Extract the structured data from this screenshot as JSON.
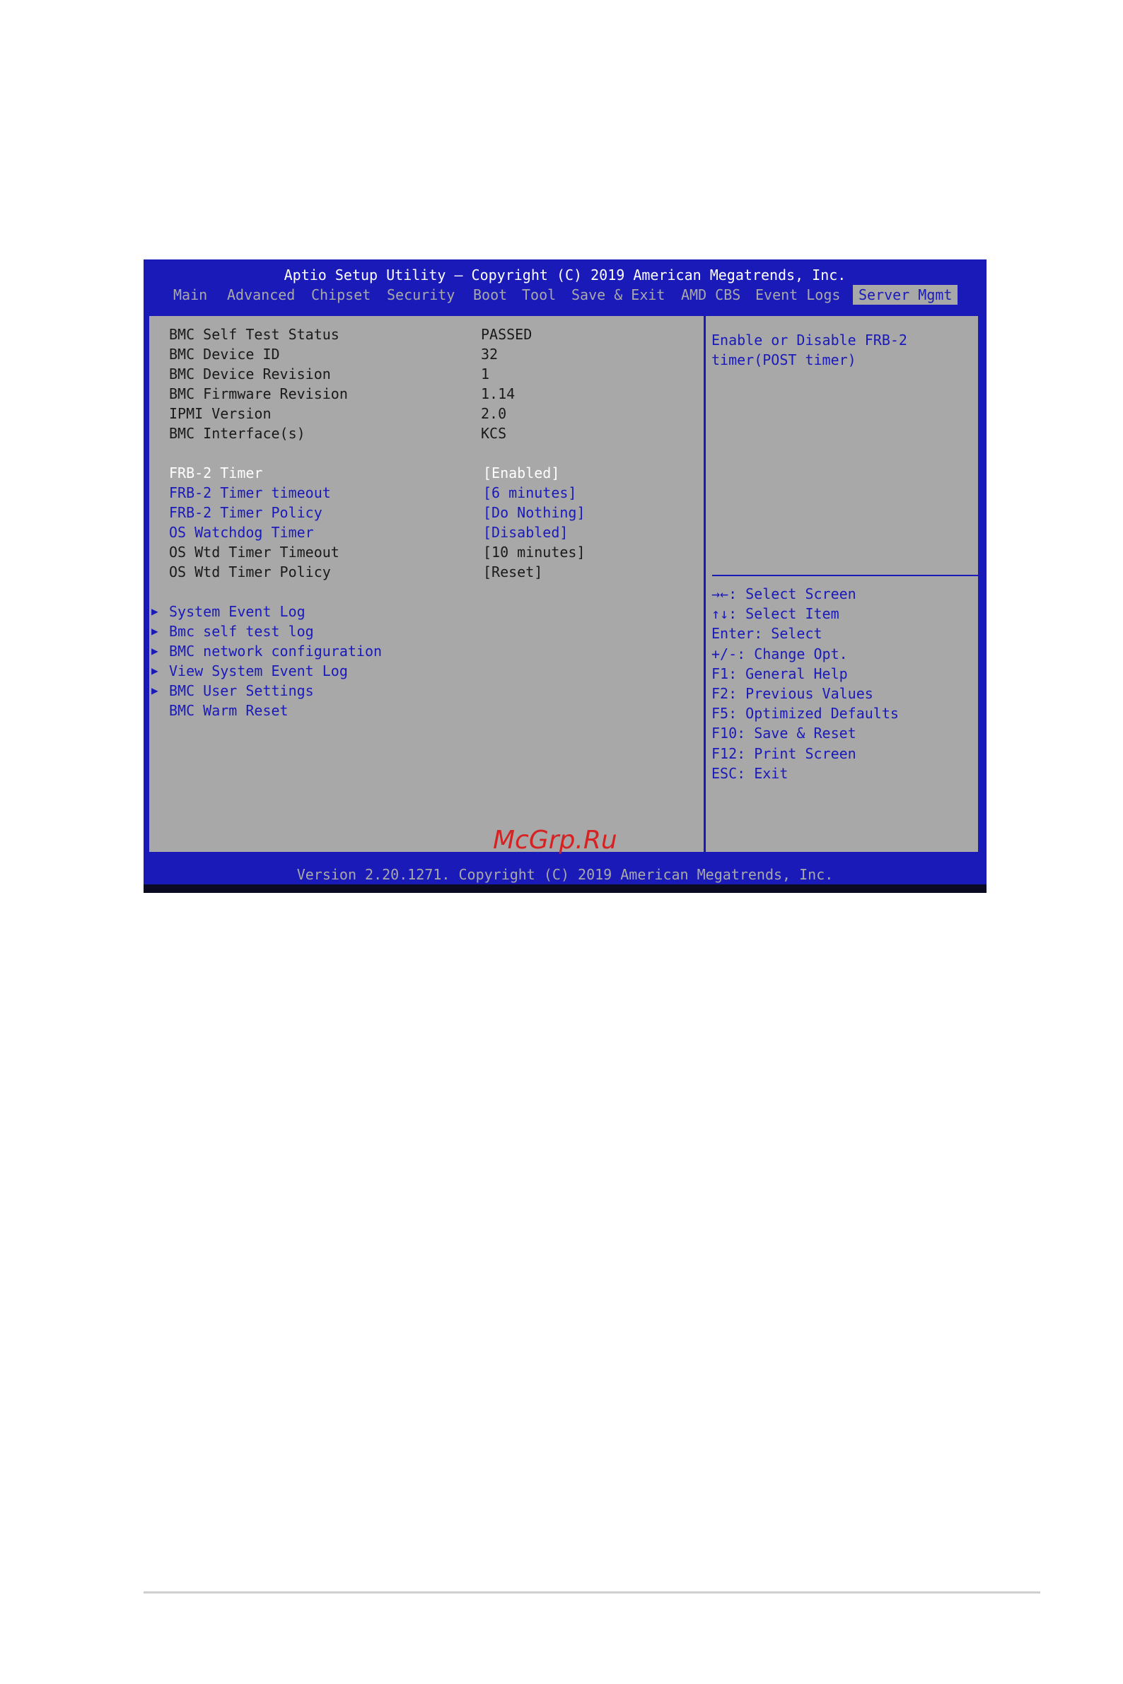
{
  "header": {
    "title": "Aptio Setup Utility – Copyright (C) 2019 American Megatrends, Inc.",
    "tabs": [
      {
        "label": "Main",
        "active": false
      },
      {
        "label": "Advanced",
        "active": false
      },
      {
        "label": "Chipset",
        "active": false
      },
      {
        "label": "Security",
        "active": false
      },
      {
        "label": "Boot",
        "active": false
      },
      {
        "label": "Tool",
        "active": false
      },
      {
        "label": "Save & Exit",
        "active": false
      },
      {
        "label": "AMD CBS",
        "active": false
      },
      {
        "label": "Event Logs",
        "active": false
      },
      {
        "label": "Server Mgmt",
        "active": true
      }
    ]
  },
  "info_items": [
    {
      "label": "BMC Self Test Status",
      "value": "PASSED"
    },
    {
      "label": "BMC Device ID",
      "value": "32"
    },
    {
      "label": "BMC Device Revision",
      "value": "1"
    },
    {
      "label": "BMC Firmware Revision",
      "value": "1.14"
    },
    {
      "label": "IPMI Version",
      "value": "2.0"
    },
    {
      "label": "BMC Interface(s)",
      "value": "KCS"
    }
  ],
  "settings": [
    {
      "label": "FRB-2 Timer",
      "value": "[Enabled]"
    },
    {
      "label": "FRB-2 Timer timeout",
      "value": "[6 minutes]"
    },
    {
      "label": "FRB-2 Timer Policy",
      "value": "[Do Nothing]"
    },
    {
      "label": "OS Watchdog Timer",
      "value": "[Disabled]"
    },
    {
      "label": "OS Wtd Timer Timeout",
      "value": "[10 minutes]"
    },
    {
      "label": "OS Wtd Timer Policy",
      "value": "[Reset]"
    }
  ],
  "submenus": [
    {
      "label": "System Event Log",
      "arrow": "▶"
    },
    {
      "label": "Bmc self test log",
      "arrow": "▶"
    },
    {
      "label": "BMC network configuration",
      "arrow": "▶"
    },
    {
      "label": "View System Event Log",
      "arrow": "▶"
    },
    {
      "label": "BMC User Settings",
      "arrow": "▶"
    },
    {
      "label": "BMC Warm Reset",
      "arrow": ""
    }
  ],
  "help": {
    "line1": "Enable or Disable FRB-2",
    "line2": "timer(POST timer)"
  },
  "keys": [
    "→←: Select Screen",
    "↑↓: Select Item",
    "Enter: Select",
    "+/-: Change Opt.",
    "F1: General Help",
    "F2: Previous Values",
    "F5: Optimized Defaults",
    "F10: Save & Reset",
    "F12: Print Screen",
    "ESC: Exit"
  ],
  "footer": "Version 2.20.1271. Copyright (C) 2019 American Megatrends, Inc.",
  "watermark": "McGrp.Ru",
  "colors": {
    "frame_blue": "#1a1ab8",
    "panel_gray": "#a8a8a8",
    "highlight_white": "#ffffff",
    "watermark_red": "#d62222"
  }
}
